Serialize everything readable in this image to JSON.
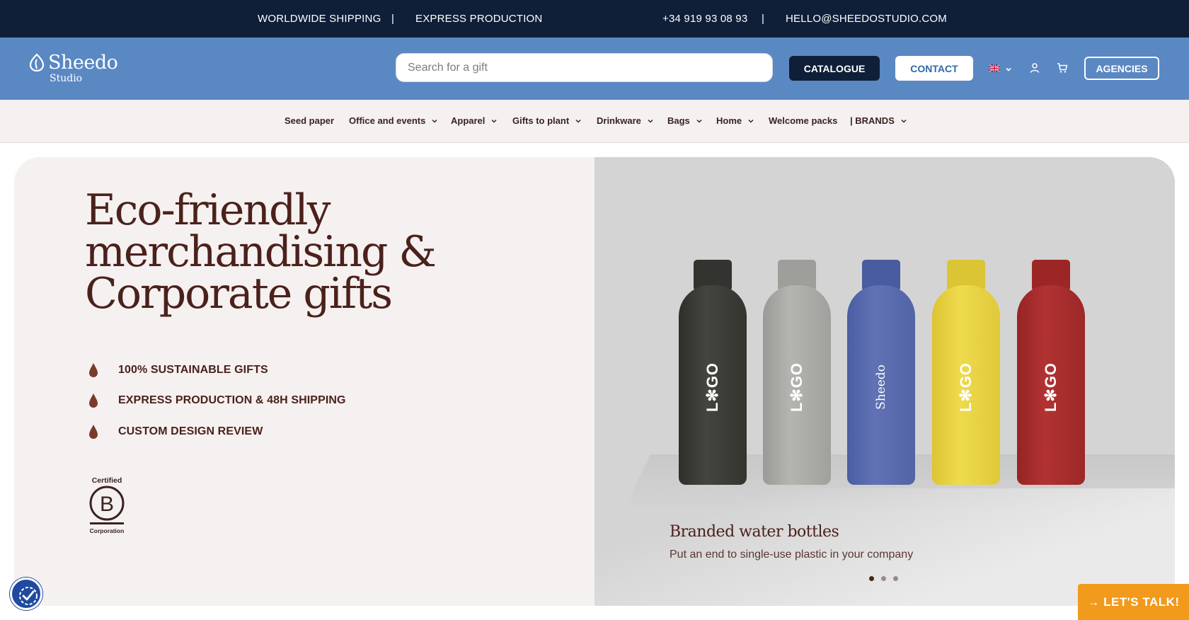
{
  "topbar": {
    "shipping": "WORLDWIDE SHIPPING",
    "sep": "|",
    "express": "EXPRESS PRODUCTION",
    "phone": "+34 919 93 08 93",
    "email": "HELLO@SHEEDOSTUDIO.COM"
  },
  "header": {
    "logo_name": "Sheedo",
    "logo_sub": "Studio",
    "search_placeholder": "Search for a gift",
    "catalogue": "CATALOGUE",
    "contact": "CONTACT",
    "agencies": "AGENCIES",
    "language_icon": "uk-flag-icon"
  },
  "nav": {
    "items": [
      {
        "label": "Seed paper",
        "dropdown": false
      },
      {
        "label": "Office and events",
        "dropdown": true
      },
      {
        "label": "Apparel",
        "dropdown": true
      },
      {
        "label": "Gifts to plant",
        "dropdown": true
      },
      {
        "label": "Drinkware",
        "dropdown": true
      },
      {
        "label": "Bags",
        "dropdown": true
      },
      {
        "label": "Home",
        "dropdown": true
      },
      {
        "label": "Welcome packs",
        "dropdown": false
      },
      {
        "label": "| BRANDS",
        "dropdown": true
      }
    ]
  },
  "hero": {
    "headline": [
      "Eco-friendly",
      "merchandising &",
      "Corporate gifts"
    ],
    "features": [
      "100% SUSTAINABLE GIFTS",
      "EXPRESS PRODUCTION & 48H SHIPPING",
      "CUSTOM DESIGN REVIEW"
    ],
    "badge": "Certified B Corporation",
    "slide": {
      "title": "Branded water bottles",
      "subtitle": "Put an end to single-use plastic in your company",
      "current": 1,
      "total": 3
    },
    "bottles": [
      {
        "label": "L✻GO",
        "color": "#3a3a36"
      },
      {
        "label": "L✻GO",
        "color": "#a8a8a4"
      },
      {
        "label": "Sheedo",
        "color": "#5163a8"
      },
      {
        "label": "L✻GO",
        "color": "#e3cd3a"
      },
      {
        "label": "L✻GO",
        "color": "#a32a2a"
      }
    ]
  },
  "floating": {
    "talk": "→ LET'S TALK!"
  },
  "colors": {
    "topbar": "#0f1f38",
    "header": "#5a88c3",
    "brown": "#4b211c",
    "orange": "#f19a1b",
    "a11y": "#1f4aa0"
  }
}
